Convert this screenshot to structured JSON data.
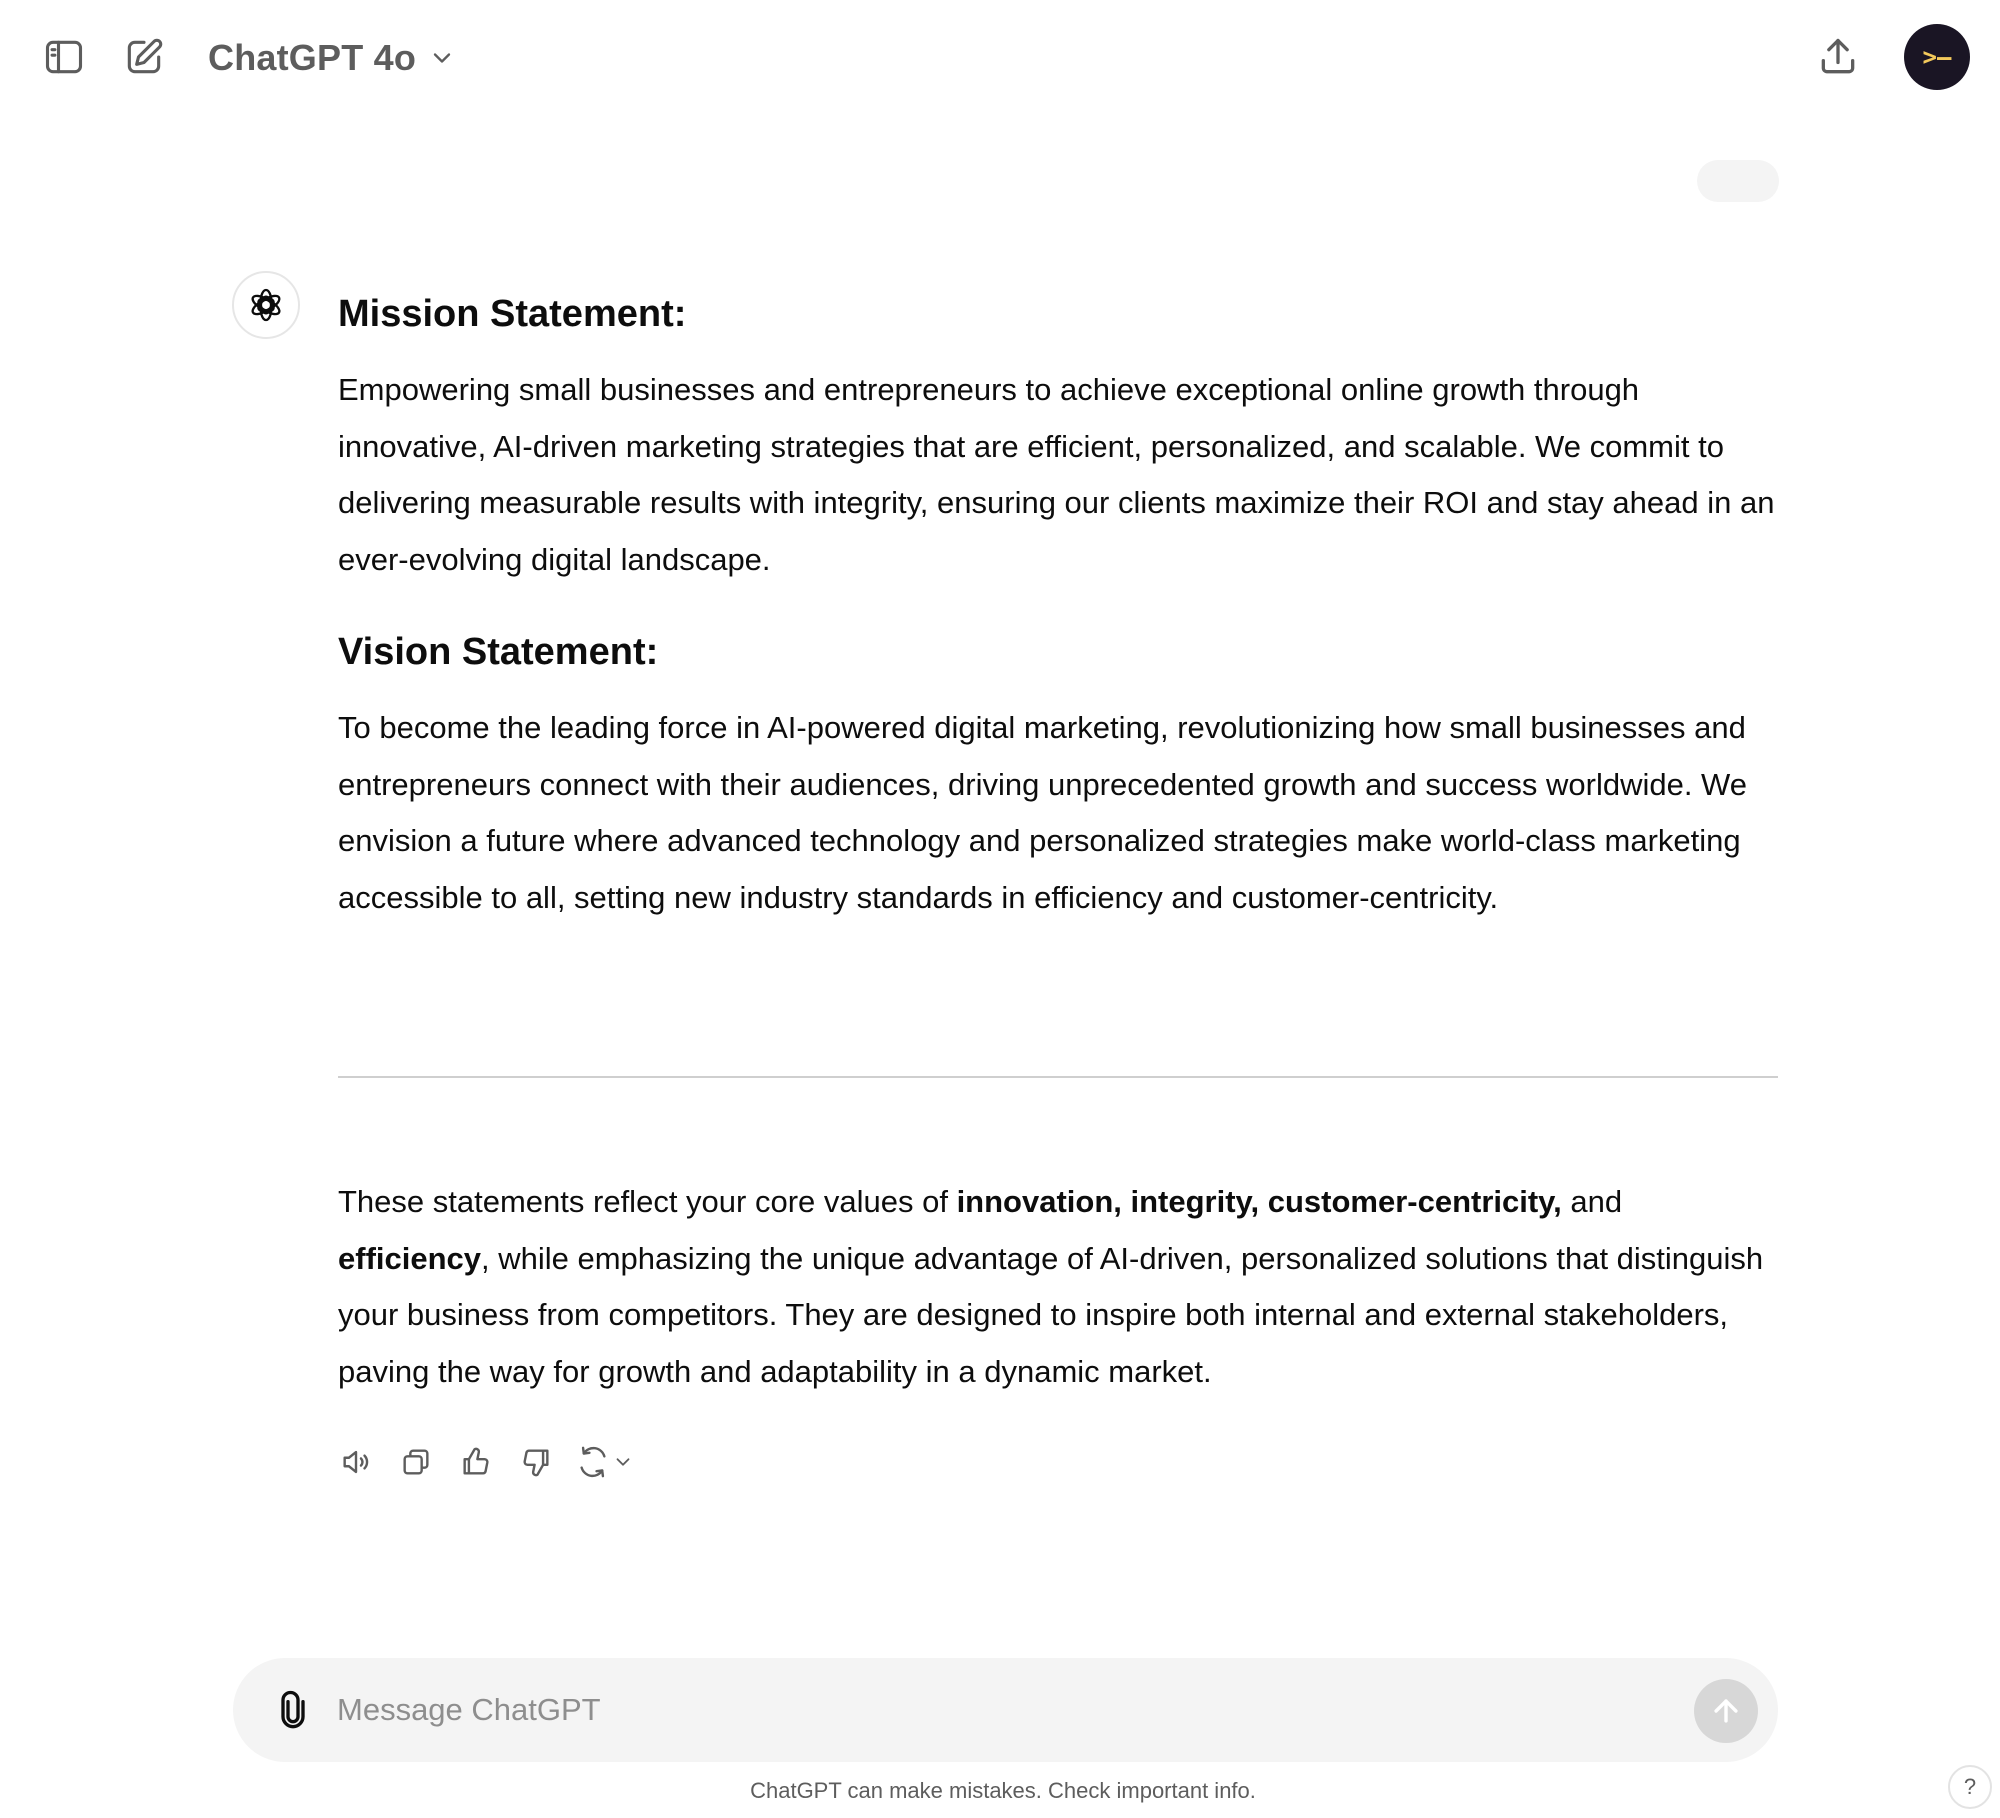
{
  "header": {
    "model_name": "ChatGPT 4o",
    "avatar_text": ">–"
  },
  "assistant": {
    "sections": [
      {
        "heading": "Mission Statement:",
        "text": "Empowering small businesses and entrepreneurs to achieve exceptional online growth through innovative, AI-driven marketing strategies that are efficient, personalized, and scalable. We commit to delivering measurable results with integrity, ensuring our clients maximize their ROI and stay ahead in an ever-evolving digital landscape."
      },
      {
        "heading": "Vision Statement:",
        "text": "To become the leading force in AI-powered digital marketing, revolutionizing how small businesses and entrepreneurs connect with their audiences, driving unprecedented growth and success worldwide. We envision a future where advanced technology and personalized strategies make world-class marketing accessible to all, setting new industry standards in efficiency and customer-centricity."
      }
    ],
    "summary": {
      "prefix": "These statements reflect your core values of ",
      "bold_values": "innovation, integrity, customer-centricity,",
      "and_text": " and ",
      "bold_last": "efficiency",
      "suffix": ", while emphasizing the unique advantage of AI-driven, personalized solutions that distinguish your business from competitors. They are designed to inspire both internal and external stakeholders, paving the way for growth and adaptability in a dynamic market."
    }
  },
  "composer": {
    "placeholder": "Message ChatGPT"
  },
  "footer": {
    "disclaimer": "ChatGPT can make mistakes. Check important info.",
    "help_label": "?"
  },
  "icons": {
    "sidebar_toggle": "sidebar-toggle-icon",
    "new_chat": "edit-icon",
    "share": "share-icon",
    "read_aloud": "speaker-icon",
    "copy": "copy-icon",
    "thumbs_up": "thumbs-up-icon",
    "thumbs_down": "thumbs-down-icon",
    "regenerate": "refresh-icon",
    "attach": "paperclip-icon",
    "send": "arrow-up-icon"
  },
  "colors": {
    "avatar_bg": "#1a1524",
    "avatar_fg": "#f3c95b",
    "composer_bg": "#f4f4f4",
    "send_disabled": "#d7d7d7"
  }
}
